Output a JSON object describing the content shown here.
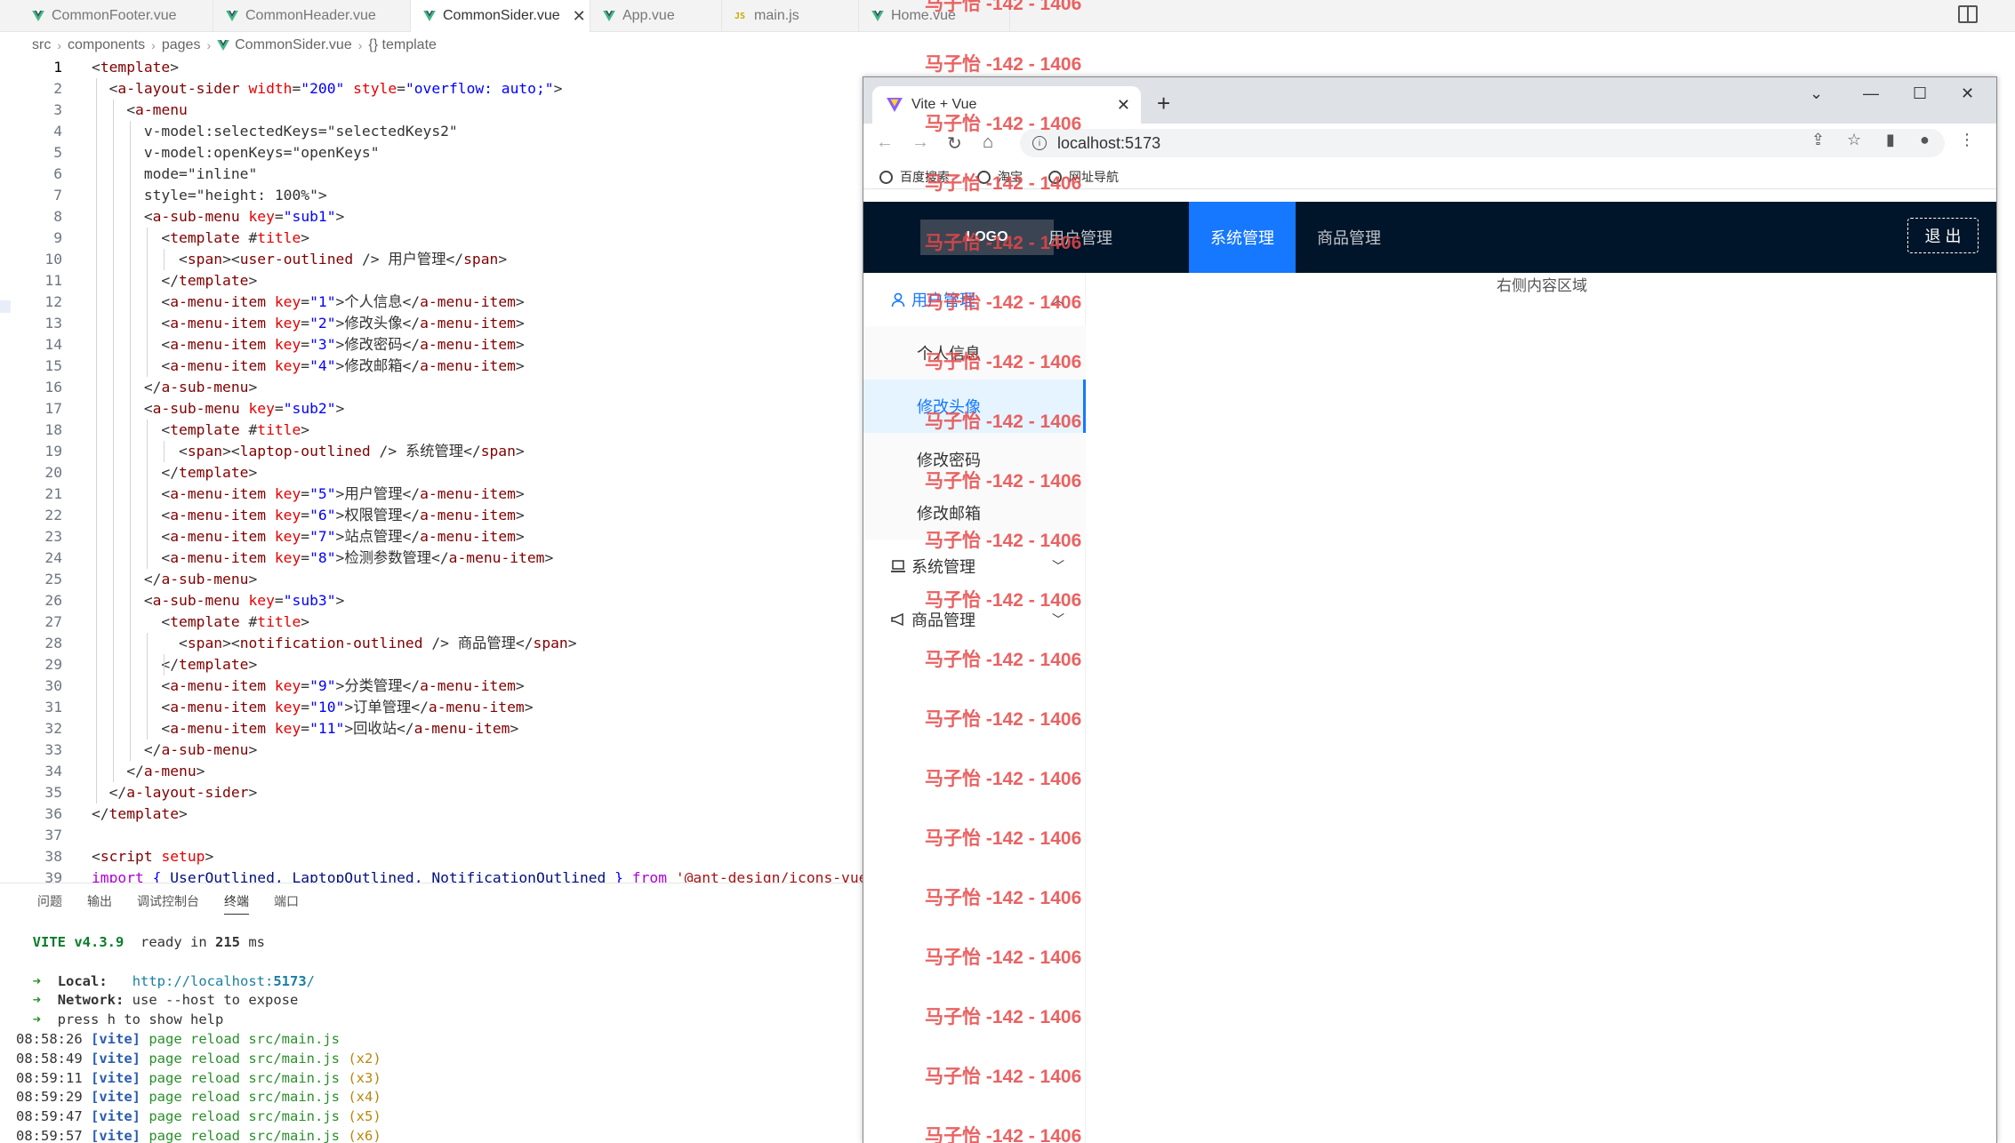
{
  "editor_tabs": [
    {
      "label": "CommonFooter.vue",
      "icon": "vue-icon"
    },
    {
      "label": "CommonHeader.vue",
      "icon": "vue-icon"
    },
    {
      "label": "CommonSider.vue",
      "icon": "vue-icon",
      "active": true,
      "close": "✕"
    },
    {
      "label": "App.vue",
      "icon": "vue-icon"
    },
    {
      "label": "main.js",
      "icon": "js-icon",
      "js_badge": "JS"
    },
    {
      "label": "Home.vue",
      "icon": "vue-icon"
    }
  ],
  "breadcrumb": [
    "src",
    "components",
    "pages",
    "CommonSider.vue",
    "{} template"
  ],
  "code_lines": [
    "<template>",
    "  <a-layout-sider width=\"200\" style=\"overflow: auto;\">",
    "    <a-menu",
    "      v-model:selectedKeys=\"selectedKeys2\"",
    "      v-model:openKeys=\"openKeys\"",
    "      mode=\"inline\"",
    "      style=\"height: 100%\">",
    "      <a-sub-menu key=\"sub1\">",
    "        <template #title>",
    "          <span><user-outlined /> 用户管理</span>",
    "        </template>",
    "        <a-menu-item key=\"1\">个人信息</a-menu-item>",
    "        <a-menu-item key=\"2\">修改头像</a-menu-item>",
    "        <a-menu-item key=\"3\">修改密码</a-menu-item>",
    "        <a-menu-item key=\"4\">修改邮箱</a-menu-item>",
    "      </a-sub-menu>",
    "      <a-sub-menu key=\"sub2\">",
    "        <template #title>",
    "          <span><laptop-outlined /> 系统管理</span>",
    "        </template>",
    "        <a-menu-item key=\"5\">用户管理</a-menu-item>",
    "        <a-menu-item key=\"6\">权限管理</a-menu-item>",
    "        <a-menu-item key=\"7\">站点管理</a-menu-item>",
    "        <a-menu-item key=\"8\">检测参数管理</a-menu-item>",
    "      </a-sub-menu>",
    "      <a-sub-menu key=\"sub3\">",
    "        <template #title>",
    "          <span><notification-outlined /> 商品管理</span>",
    "        </template>",
    "        <a-menu-item key=\"9\">分类管理</a-menu-item>",
    "        <a-menu-item key=\"10\">订单管理</a-menu-item>",
    "        <a-menu-item key=\"11\">回收站</a-menu-item>",
    "      </a-sub-menu>",
    "    </a-menu>",
    "  </a-layout-sider>",
    "</template>",
    "",
    "<script setup>",
    "import { UserOutlined, LaptopOutlined, NotificationOutlined } from '@ant-design/icons-vue'"
  ],
  "panel": {
    "tabs": [
      "问题",
      "输出",
      "调试控制台",
      "终端",
      "端口"
    ],
    "active_tab": "终端",
    "terminal": {
      "vite_name": "VITE",
      "vite_version": "v4.3.9",
      "ready_text": "ready in",
      "ready_ms": "215",
      "ms_unit": "ms",
      "arrow": "➜",
      "local_label": "Local:",
      "local_url_prefix": "http://localhost:",
      "local_port": "5173",
      "local_url_suffix": "/",
      "network_label": "Network:",
      "network_text": "use --host to expose",
      "help_text": "press h to show help",
      "logs": [
        {
          "time": "08:58:26",
          "tag": "[vite]",
          "msg": "page reload src/main.js",
          "count": ""
        },
        {
          "time": "08:58:49",
          "tag": "[vite]",
          "msg": "page reload src/main.js",
          "count": "(x2)"
        },
        {
          "time": "08:59:11",
          "tag": "[vite]",
          "msg": "page reload src/main.js",
          "count": "(x3)"
        },
        {
          "time": "08:59:29",
          "tag": "[vite]",
          "msg": "page reload src/main.js",
          "count": "(x4)"
        },
        {
          "time": "08:59:47",
          "tag": "[vite]",
          "msg": "page reload src/main.js",
          "count": "(x5)"
        },
        {
          "time": "08:59:57",
          "tag": "[vite]",
          "msg": "page reload src/main.js",
          "count": "(x6)"
        }
      ]
    }
  },
  "browser": {
    "tab_title": "Vite + Vue",
    "tab_close": "✕",
    "new_tab": "+",
    "url": "localhost:5173",
    "bookmarks": [
      "百度搜索",
      "淘宝",
      "网址导航"
    ],
    "page": {
      "logo": "LOGO",
      "header_nav": [
        "用户管理",
        "系统管理",
        "商品管理"
      ],
      "header_selected": "系统管理",
      "logout": "退 出",
      "menu": {
        "sub1_title": "用户管理",
        "sub1_items": [
          "个人信息",
          "修改头像",
          "修改密码",
          "修改邮箱"
        ],
        "selected": "修改头像",
        "sub2_title": "系统管理",
        "sub3_title": "商品管理"
      },
      "content": "右侧内容区域"
    }
  },
  "watermark": "马子怡 -142 - 1406",
  "colors": {
    "primary": "#1677ff",
    "header_bg": "#001529",
    "selected_bg": "#e6f4ff"
  }
}
